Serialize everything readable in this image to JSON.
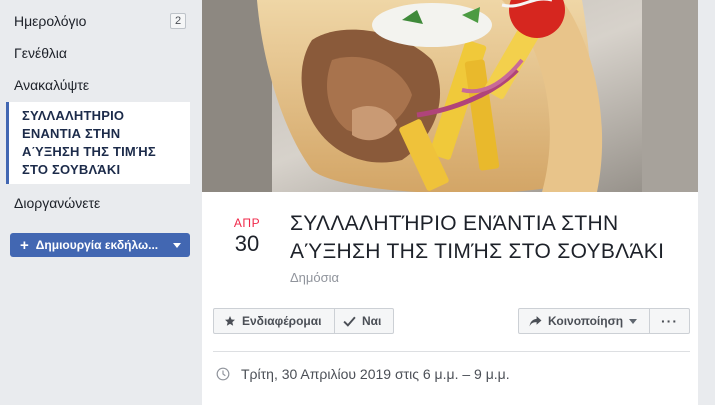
{
  "sidebar": {
    "items": [
      {
        "label": "Ημερολόγιο",
        "badge": "2"
      },
      {
        "label": "Γενέθλια"
      },
      {
        "label": "Ανακαλύψτε"
      }
    ],
    "selected": {
      "lines": [
        "ΣΥΛΛΑΛΗΤΗΡΙΟ",
        "ΕΝΑΝΤΙΑ ΣΤΗΝ",
        "ΑΎΞΗΣΗ ΤΗΣ ΤΙΜΉΣ",
        "ΣΤΟ ΣΟΥΒΛΆΚΙ"
      ]
    },
    "organize_label": "Διοργανώνετε",
    "create_button": {
      "label": "Δημιουργία εκδήλω...",
      "icon": "plus-icon"
    }
  },
  "event": {
    "cover_description_icon": "souvlaki-photo",
    "date": {
      "month": "ΑΠΡ",
      "day": "30"
    },
    "title_lines": [
      "ΣΥΛΛΑΛΗΤΉΡΙΟ ΕΝΆΝΤΙΑ ΣΤΗΝ",
      "ΑΎΞΗΣΗ ΤΗΣ ΤΙΜΉΣ ΣΤΟ ΣΟΥΒΛΆΚΙ"
    ],
    "privacy": "Δημόσια",
    "actions": {
      "interested": {
        "label": "Ενδιαφέρομαι",
        "icon": "star-icon"
      },
      "yes": {
        "label": "Ναι",
        "icon": "check-icon"
      },
      "share": {
        "label": "Κοινοποίηση",
        "icon": "share-arrow-icon"
      },
      "more": {
        "label": "···",
        "icon": "more-icon"
      }
    },
    "time": {
      "text": "Τρίτη, 30 Απριλίου 2019 στις 6 μ.μ. – 9 μ.μ.",
      "icon": "clock-icon"
    }
  },
  "colors": {
    "accent": "#4267b2",
    "date_month": "#f02849",
    "background": "#e9ebee"
  }
}
